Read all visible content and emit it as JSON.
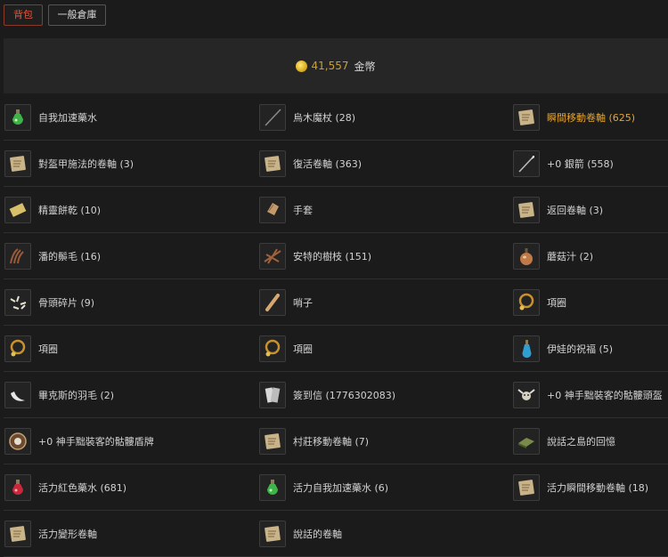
{
  "tabs": [
    {
      "label": "背包",
      "active": true
    },
    {
      "label": "一般倉庫",
      "active": false
    }
  ],
  "gold": {
    "amount": "41,557",
    "unit": "金幣",
    "icon": "gold-coin-icon",
    "amount_color": "#c9a13a"
  },
  "items": [
    [
      {
        "label": "自我加速藥水",
        "icon": "green-potion-icon"
      },
      {
        "label": "烏木魔杖 (28)",
        "icon": "ebony-wand-icon"
      },
      {
        "label": "瞬間移動卷軸 (625)",
        "icon": "scroll-icon",
        "highlight": true
      }
    ],
    [
      {
        "label": "對盔甲施法的卷軸 (3)",
        "icon": "scroll-icon"
      },
      {
        "label": "復活卷軸 (363)",
        "icon": "scroll-icon"
      },
      {
        "label": "+0 銀箭 (558)",
        "icon": "silver-arrow-icon"
      }
    ],
    [
      {
        "label": "精靈餅乾 (10)",
        "icon": "elven-wafer-icon"
      },
      {
        "label": "手套",
        "icon": "gloves-icon"
      },
      {
        "label": "返回卷軸 (3)",
        "icon": "scroll-icon"
      }
    ],
    [
      {
        "label": "潘的鬃毛 (16)",
        "icon": "mane-icon"
      },
      {
        "label": "安特的樹枝 (151)",
        "icon": "branch-icon"
      },
      {
        "label": "蘑菇汁 (2)",
        "icon": "mushroom-juice-icon"
      }
    ],
    [
      {
        "label": "骨頭碎片 (9)",
        "icon": "bone-fragments-icon"
      },
      {
        "label": "哨子",
        "icon": "whistle-icon"
      },
      {
        "label": "項圈",
        "icon": "collar-icon"
      }
    ],
    [
      {
        "label": "項圈",
        "icon": "collar-icon"
      },
      {
        "label": "項圈",
        "icon": "collar-icon"
      },
      {
        "label": "伊娃的祝福 (5)",
        "icon": "blue-potion-icon"
      }
    ],
    [
      {
        "label": "畢克斯的羽毛 (2)",
        "icon": "feather-icon"
      },
      {
        "label": "簽到信 (1776302083)",
        "icon": "letter-icon"
      },
      {
        "label": "+0 神手黜裝客的骷髏頭盔",
        "icon": "skull-helmet-icon"
      }
    ],
    [
      {
        "label": "+0 神手黜裝客的骷髏盾牌",
        "icon": "skull-shield-icon"
      },
      {
        "label": "村莊移動卷軸 (7)",
        "icon": "scroll-icon"
      },
      {
        "label": "說話之島的回憶",
        "icon": "memory-book-icon"
      }
    ],
    [
      {
        "label": "活力紅色藥水 (681)",
        "icon": "red-potion-icon"
      },
      {
        "label": "活力自我加速藥水 (6)",
        "icon": "green-potion-icon"
      },
      {
        "label": "活力瞬間移動卷軸 (18)",
        "icon": "scroll-icon"
      }
    ],
    [
      {
        "label": "活力變形卷軸",
        "icon": "scroll-icon"
      },
      {
        "label": "說話的卷軸",
        "icon": "scroll-icon"
      },
      null
    ]
  ]
}
